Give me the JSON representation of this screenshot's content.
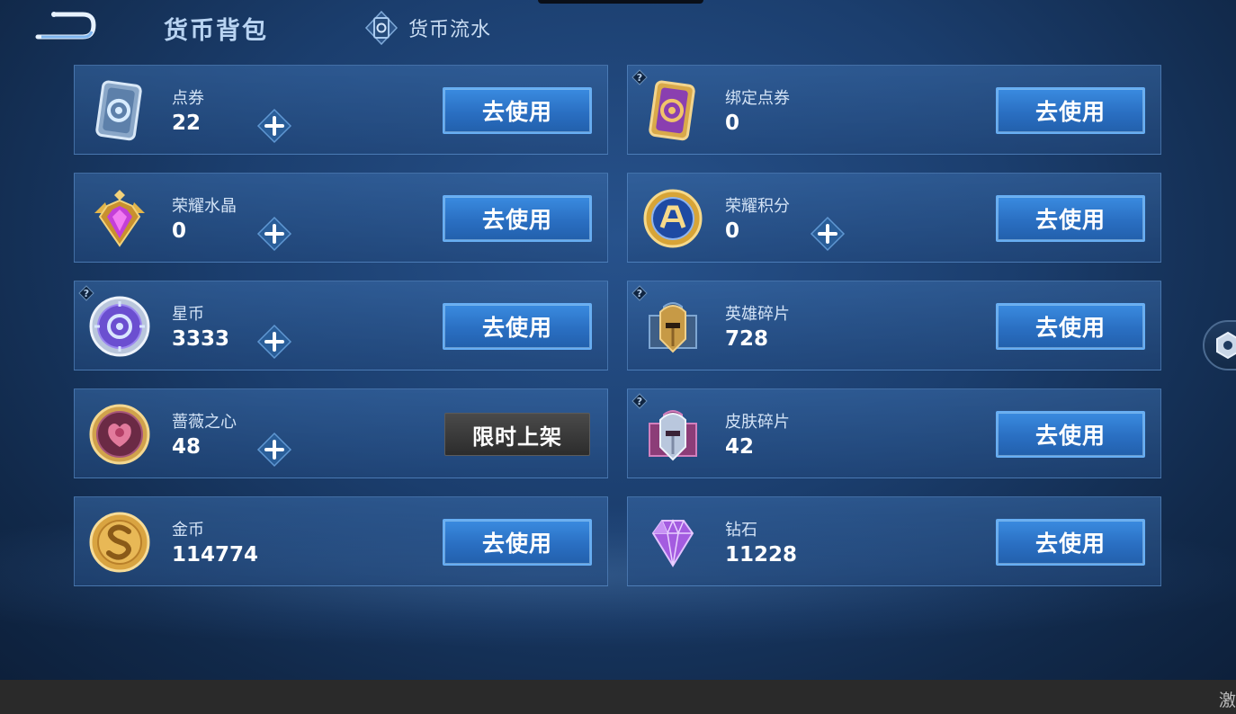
{
  "header": {
    "title": "货币背包",
    "history_tab": "货币流水"
  },
  "currencies": [
    {
      "name": "点券",
      "value": "22",
      "button": "去使用",
      "has_plus": true,
      "has_help": false,
      "icon": "coupon-card-icon"
    },
    {
      "name": "绑定点券",
      "value": "0",
      "button": "去使用",
      "has_plus": false,
      "has_help": true,
      "icon": "bound-coupon-card-icon"
    },
    {
      "name": "荣耀水晶",
      "value": "0",
      "button": "去使用",
      "has_plus": true,
      "has_help": false,
      "icon": "glory-crystal-icon"
    },
    {
      "name": "荣耀积分",
      "value": "0",
      "button": "去使用",
      "has_plus": true,
      "has_help": false,
      "icon": "glory-points-icon"
    },
    {
      "name": "星币",
      "value": "3333",
      "button": "去使用",
      "has_plus": true,
      "has_help": true,
      "icon": "star-coin-icon"
    },
    {
      "name": "英雄碎片",
      "value": "728",
      "button": "去使用",
      "has_plus": false,
      "has_help": true,
      "icon": "hero-shard-icon"
    },
    {
      "name": "蔷薇之心",
      "value": "48",
      "button": "限时上架",
      "has_plus": true,
      "has_help": false,
      "icon": "rose-heart-icon"
    },
    {
      "name": "皮肤碎片",
      "value": "42",
      "button": "去使用",
      "has_plus": false,
      "has_help": true,
      "icon": "skin-shard-icon"
    },
    {
      "name": "金币",
      "value": "114774",
      "button": "去使用",
      "has_plus": false,
      "has_help": false,
      "icon": "gold-coin-icon"
    },
    {
      "name": "钻石",
      "value": "11228",
      "button": "去使用",
      "has_plus": false,
      "has_help": false,
      "icon": "diamond-icon"
    }
  ],
  "corner_text": "激",
  "colors": {
    "button_blue": "#2a6fc2",
    "button_border": "#67aef3",
    "limited_button": "#3a3a3a",
    "background": "#1b3e6e"
  }
}
